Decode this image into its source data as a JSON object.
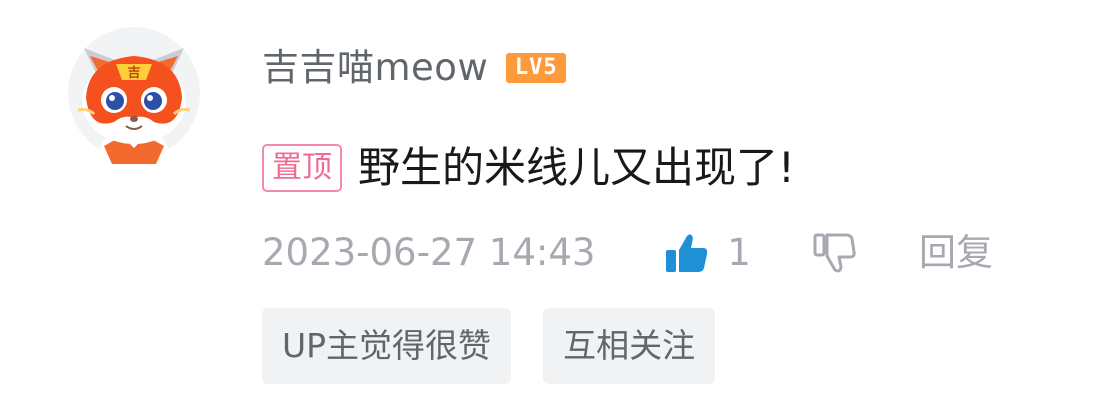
{
  "comment": {
    "username": "吉吉喵meow",
    "level_badge": "LV5",
    "pin_tag": "置顶",
    "content": "野生的米线儿又出现了!",
    "timestamp": "2023-06-27 14:43",
    "like_count": "1",
    "reply_label": "回复",
    "quick_tags": [
      {
        "label": "UP主觉得很赞"
      },
      {
        "label": "互相关注"
      }
    ]
  },
  "icons": {
    "avatar": "orange-cat-mascot-avatar",
    "like": "thumbs-up-icon",
    "dislike": "thumbs-down-icon"
  },
  "colors": {
    "username": "#61666d",
    "level_badge": "#ff9a3c",
    "pin_tag": "#f26b93",
    "like_active": "#1e90d8",
    "meta": "#a6aab0",
    "chip_bg": "#f1f2f3"
  }
}
